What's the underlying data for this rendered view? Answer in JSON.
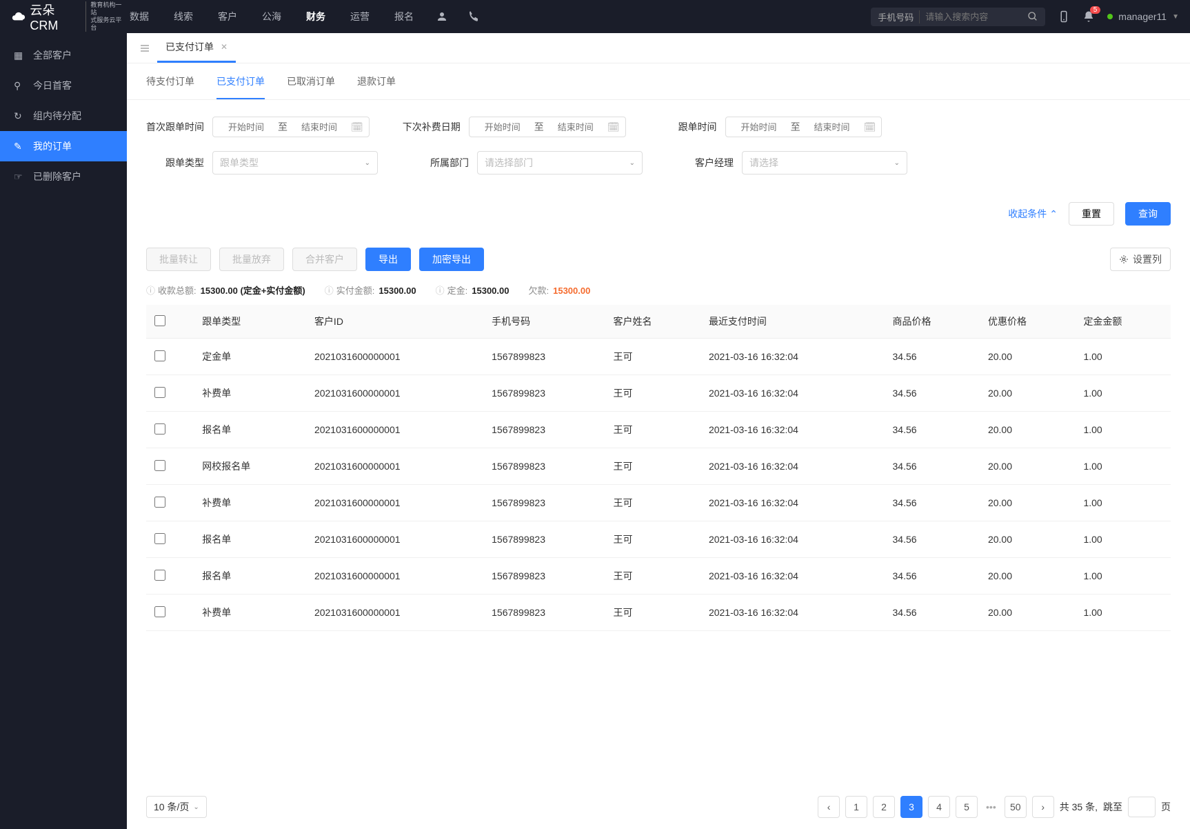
{
  "header": {
    "logo": "云朵CRM",
    "tagline1": "教育机构一站",
    "tagline2": "式服务云平台",
    "nav": [
      "数据",
      "线索",
      "客户",
      "公海",
      "财务",
      "运营",
      "报名"
    ],
    "nav_active_idx": 4,
    "search_type": "手机号码",
    "search_placeholder": "请输入搜索内容",
    "badge_count": "5",
    "username": "manager11"
  },
  "sidebar": {
    "items": [
      {
        "label": "全部客户"
      },
      {
        "label": "今日首客"
      },
      {
        "label": "组内待分配"
      },
      {
        "label": "我的订单"
      },
      {
        "label": "已删除客户"
      }
    ],
    "active_idx": 3
  },
  "tab": {
    "label": "已支付订单"
  },
  "subtabs": {
    "items": [
      "待支付订单",
      "已支付订单",
      "已取消订单",
      "退款订单"
    ],
    "active_idx": 1
  },
  "filter": {
    "f1": {
      "label": "首次跟单时间",
      "p1": "开始时间",
      "sep": "至",
      "p2": "结束时间"
    },
    "f2": {
      "label": "下次补费日期",
      "p1": "开始时间",
      "sep": "至",
      "p2": "结束时间"
    },
    "f3": {
      "label": "跟单时间",
      "p1": "开始时间",
      "sep": "至",
      "p2": "结束时间"
    },
    "f4": {
      "label": "跟单类型",
      "ph": "跟单类型"
    },
    "f5": {
      "label": "所属部门",
      "ph": "请选择部门"
    },
    "f6": {
      "label": "客户经理",
      "ph": "请选择"
    },
    "collapse": "收起条件",
    "reset": "重置",
    "query": "查询"
  },
  "actions": {
    "batch_transfer": "批量转让",
    "batch_abandon": "批量放弃",
    "merge": "合并客户",
    "export": "导出",
    "enc_export": "加密导出",
    "set_cols": "设置列"
  },
  "summary": {
    "s1_l": "收款总额:",
    "s1_v": "15300.00 (定金+实付金额)",
    "s2_l": "实付金额:",
    "s2_v": "15300.00",
    "s3_l": "定金:",
    "s3_v": "15300.00",
    "s4_l": "欠款:",
    "s4_v": "15300.00"
  },
  "table": {
    "headers": [
      "跟单类型",
      "客户ID",
      "手机号码",
      "客户姓名",
      "最近支付时间",
      "商品价格",
      "优惠价格",
      "定金金额"
    ],
    "rows": [
      {
        "c": [
          "定金单",
          "2021031600000001",
          "1567899823",
          "王可",
          "2021-03-16 16:32:04",
          "34.56",
          "20.00",
          "1.00"
        ]
      },
      {
        "c": [
          "补费单",
          "2021031600000001",
          "1567899823",
          "王可",
          "2021-03-16 16:32:04",
          "34.56",
          "20.00",
          "1.00"
        ]
      },
      {
        "c": [
          "报名单",
          "2021031600000001",
          "1567899823",
          "王可",
          "2021-03-16 16:32:04",
          "34.56",
          "20.00",
          "1.00"
        ]
      },
      {
        "c": [
          "网校报名单",
          "2021031600000001",
          "1567899823",
          "王可",
          "2021-03-16 16:32:04",
          "34.56",
          "20.00",
          "1.00"
        ]
      },
      {
        "c": [
          "补费单",
          "2021031600000001",
          "1567899823",
          "王可",
          "2021-03-16 16:32:04",
          "34.56",
          "20.00",
          "1.00"
        ]
      },
      {
        "c": [
          "报名单",
          "2021031600000001",
          "1567899823",
          "王可",
          "2021-03-16 16:32:04",
          "34.56",
          "20.00",
          "1.00"
        ]
      },
      {
        "c": [
          "报名单",
          "2021031600000001",
          "1567899823",
          "王可",
          "2021-03-16 16:32:04",
          "34.56",
          "20.00",
          "1.00"
        ]
      },
      {
        "c": [
          "补费单",
          "2021031600000001",
          "1567899823",
          "王可",
          "2021-03-16 16:32:04",
          "34.56",
          "20.00",
          "1.00"
        ]
      }
    ]
  },
  "pager": {
    "size": "10 条/页",
    "pages": [
      "1",
      "2",
      "3",
      "4",
      "5"
    ],
    "current_idx": 2,
    "last": "50",
    "total_pre": "共 ",
    "total": "35",
    "total_suf": " 条,",
    "jump": "跳至",
    "page_suf": "页"
  }
}
